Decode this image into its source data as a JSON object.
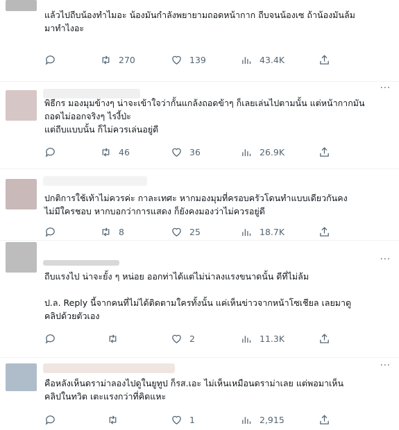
{
  "tweets": [
    {
      "text": "แล้วไปถีบน้องทำไมอะ น้องมันกำลังพยายามถอดหน้ากาก ถีบจนน้องเซ ถ้าน้องมันล้ม\nมาทำไงอะ",
      "replies": "",
      "retweets": "270",
      "likes": "139",
      "views": "43.4K"
    },
    {
      "text": "พิธีกร มองมุมข้างๆ น่าจะเข้าใจว่ากั้นแกล้งถอดข้าๆ ก็เลยเล่นไปตามนั้น แต่หน้ากากมัน\nถอดไม่ออกจริงๆ ไรงี้ป่ะ\nแต่ถีบแบบนั้น ก็ไม่ควรเล่นอยู่ดี",
      "replies": "",
      "retweets": "46",
      "likes": "36",
      "views": "26.9K"
    },
    {
      "text": "ปกติการใช้เท้าไม่ควรค่ะ กาละเทศะ หากมองมุมที่ครอบครัวโดนทำแบบเดียวกันคง\nไม่มีใครชอบ หากบอกว่าการแสดง ก็ยังคงมองว่าไม่ควรอยู่ดี",
      "replies": "",
      "retweets": "8",
      "likes": "25",
      "views": "18.7K"
    },
    {
      "text": "ถีบแรงไป น่าจะยั้ง ๆ หน่อย ออกท่าได้แต่ไม่น่าลงแรงขนาดนั้น ดีที่ไม่ล้ม\n\nป.ล. Reply นี้จากคนที่ไม่ได้ติดตามใครทั้งนั้น แค่เห็นข่าวจากหน้าโซเชียล เลยมาดู\nคลิปด้วยตัวเอง",
      "replies": "",
      "retweets": "",
      "likes": "2",
      "views": "11.3K"
    },
    {
      "text": "คือหลังเห็นดราม่าลองไปดูในยูทูป ก็รส.เอะ ไม่เห็นเหมือนดราม่าเลย แต่พอมาเห็น\nคลิปในทวิต เตะแรงกว่าที่คิดแหะ",
      "replies": "",
      "retweets": "",
      "likes": "1",
      "views": "2,915"
    }
  ],
  "icons": {
    "reply": "reply-icon",
    "retweet": "retweet-icon",
    "like": "heart-icon",
    "views": "views-icon",
    "share": "share-icon",
    "more": "more-icon"
  },
  "more_glyph": "···",
  "colors": {
    "text": "#0f1419",
    "muted": "#536471",
    "separator": "#eff3f4"
  }
}
